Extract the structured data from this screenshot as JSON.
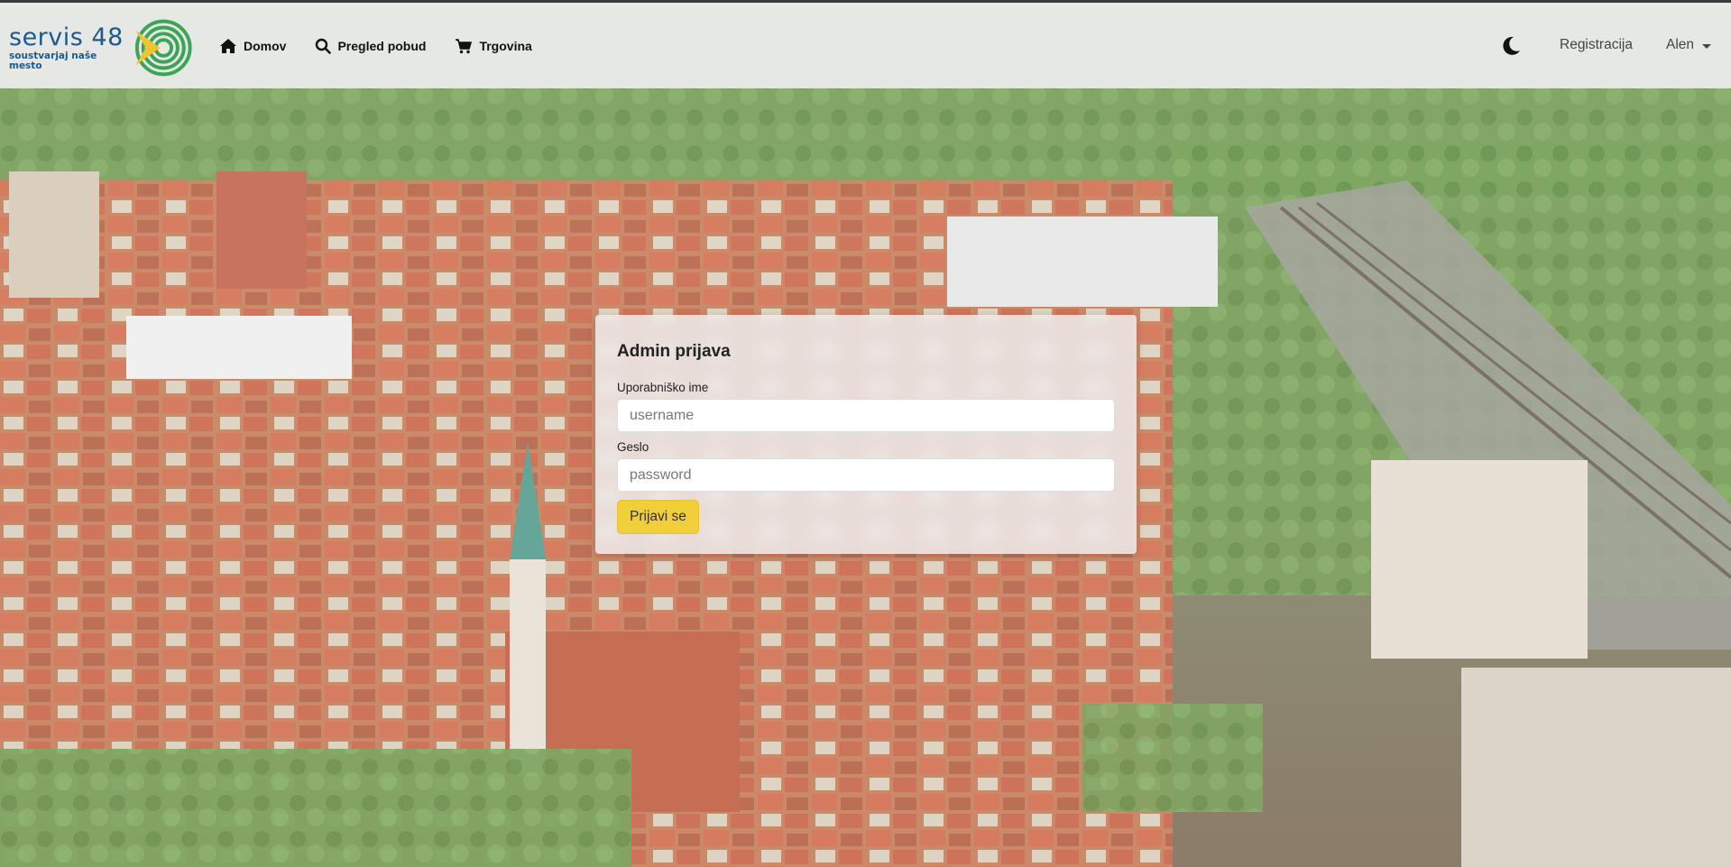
{
  "brand": {
    "name": "servis 48",
    "tagline": "soustvarjaj naše mesto",
    "color": "#1c5a8f"
  },
  "nav": {
    "items": [
      {
        "label": "Domov",
        "icon": "home-icon"
      },
      {
        "label": "Pregled pobud",
        "icon": "search-icon"
      },
      {
        "label": "Trgovina",
        "icon": "cart-icon"
      }
    ],
    "theme_toggle_icon": "moon-icon",
    "register_label": "Registracija",
    "user_label": "Alen"
  },
  "login": {
    "title": "Admin prijava",
    "username_label": "Uporabniško ime",
    "username_placeholder": "username",
    "username_value": "",
    "password_label": "Geslo",
    "password_placeholder": "password",
    "password_value": "",
    "submit_label": "Prijavi se",
    "submit_color": "#f0cf3a"
  }
}
